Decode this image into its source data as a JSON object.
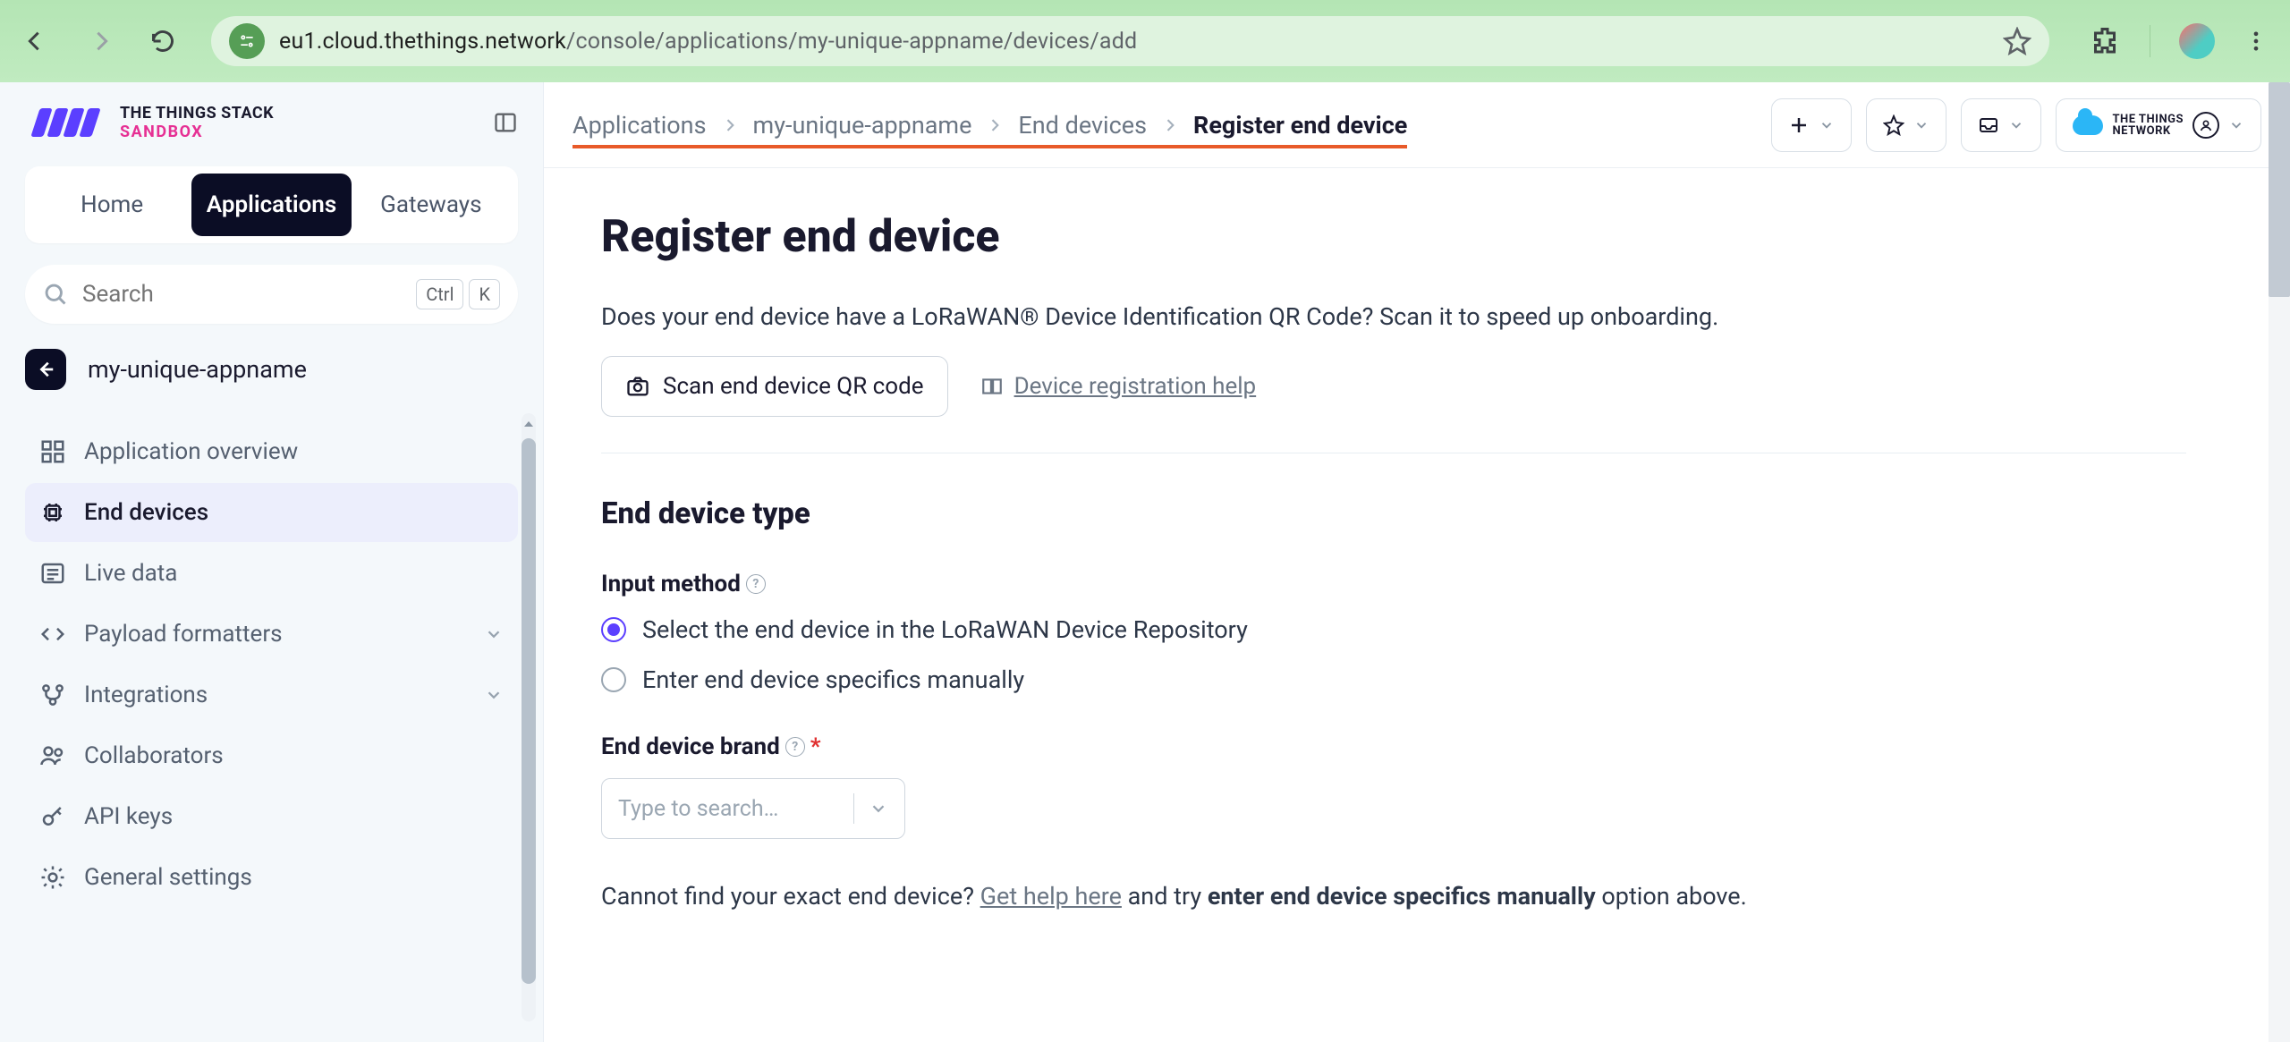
{
  "browser": {
    "url_host": "eu1.cloud.thethings.network",
    "url_path": "/console/applications/my-unique-appname/devices/add"
  },
  "logo": {
    "line1": "THE THINGS STACK",
    "line2": "SANDBOX"
  },
  "tabs": {
    "home": "Home",
    "applications": "Applications",
    "gateways": "Gateways"
  },
  "search": {
    "placeholder": "Search",
    "kbd1": "Ctrl",
    "kbd2": "K"
  },
  "context": {
    "app_name": "my-unique-appname"
  },
  "side_nav": {
    "overview": "Application overview",
    "end_devices": "End devices",
    "live_data": "Live data",
    "payload": "Payload formatters",
    "integrations": "Integrations",
    "collaborators": "Collaborators",
    "api_keys": "API keys",
    "general": "General settings"
  },
  "breadcrumbs": {
    "a": "Applications",
    "b": "my-unique-appname",
    "c": "End devices",
    "d": "Register end device"
  },
  "network_btn": {
    "l1": "THE THINGS",
    "l2": "NETWORK"
  },
  "page": {
    "title": "Register end device",
    "intro": "Does your end device have a LoRaWAN® Device Identification QR Code? Scan it to speed up onboarding.",
    "qr_button": "Scan end device QR code",
    "help_link": "Device registration help",
    "section_title": "End device type",
    "input_method_label": "Input method",
    "radio_repo": "Select the end device in the LoRaWAN Device Repository",
    "radio_manual": "Enter end device specifics manually",
    "brand_label": "End device brand",
    "brand_placeholder": "Type to search…",
    "footer_pre": "Cannot find your exact end device? ",
    "footer_link": "Get help here",
    "footer_mid": " and try ",
    "footer_bold": "enter end device specifics manually",
    "footer_post": " option above."
  }
}
